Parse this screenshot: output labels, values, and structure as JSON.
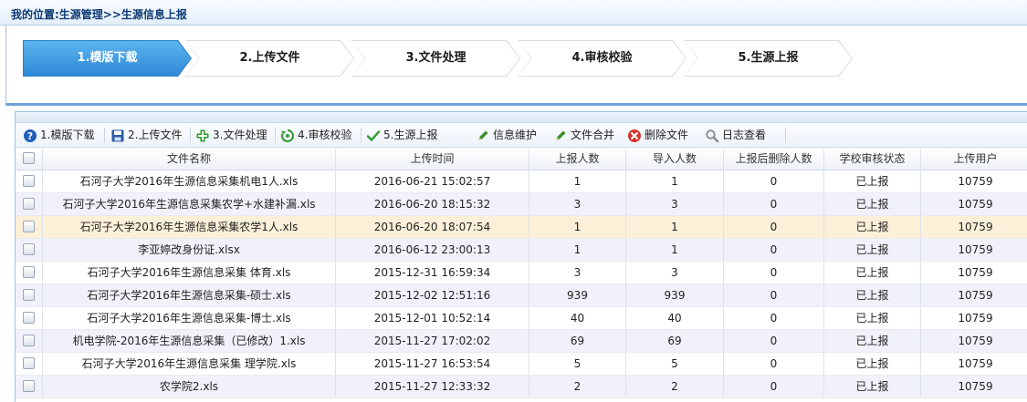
{
  "breadcrumb": "我的位置:生源管理>>生源信息上报",
  "steps": [
    {
      "label": "1.模版下载",
      "active": true
    },
    {
      "label": "2.上传文件",
      "active": false
    },
    {
      "label": "3.文件处理",
      "active": false
    },
    {
      "label": "4.审核校验",
      "active": false
    },
    {
      "label": "5.生源上报",
      "active": false
    }
  ],
  "toolbar": [
    {
      "label": "1.模版下载",
      "icon": "help-icon",
      "color": "#1f5fb8"
    },
    {
      "label": "2.上传文件",
      "icon": "save-icon",
      "color": "#2a5aa8"
    },
    {
      "label": "3.文件处理",
      "icon": "plus-icon",
      "color": "#2e9a2e"
    },
    {
      "label": "4.审核校验",
      "icon": "recycle-icon",
      "color": "#3a9a3a"
    },
    {
      "label": "5.生源上报",
      "icon": "check-icon",
      "color": "#2e9a2e"
    },
    {
      "label": "信息维护",
      "icon": "pencil-icon",
      "color": "#3f8f2f"
    },
    {
      "label": "文件合并",
      "icon": "pencil-icon",
      "color": "#3f8f2f"
    },
    {
      "label": "删除文件",
      "icon": "delete-icon",
      "color": "#d8322a"
    },
    {
      "label": "日志查看",
      "icon": "search-icon",
      "color": "#8a8a8a"
    }
  ],
  "table": {
    "columns": [
      "文件名称",
      "上传时间",
      "上报人数",
      "导入人数",
      "上报后删除人数",
      "学校审核状态",
      "上传用户"
    ],
    "rows": [
      [
        "石河子大学2016年生源信息采集机电1人.xls",
        "2016-06-21 15:02:57",
        "1",
        "1",
        "0",
        "已上报",
        "10759"
      ],
      [
        "石河子大学2016年生源信息采集农学+水建补漏.xls",
        "2016-06-20 18:15:32",
        "3",
        "3",
        "0",
        "已上报",
        "10759"
      ],
      [
        "石河子大学2016年生源信息采集农学1人.xls",
        "2016-06-20 18:07:54",
        "1",
        "1",
        "0",
        "已上报",
        "10759"
      ],
      [
        "李亚婷改身份证.xlsx",
        "2016-06-12 23:00:13",
        "1",
        "1",
        "0",
        "已上报",
        "10759"
      ],
      [
        "石河子大学2016年生源信息采集 体育.xls",
        "2015-12-31 16:59:34",
        "3",
        "3",
        "0",
        "已上报",
        "10759"
      ],
      [
        "石河子大学2016年生源信息采集-硕士.xls",
        "2015-12-02 12:51:16",
        "939",
        "939",
        "0",
        "已上报",
        "10759"
      ],
      [
        "石河子大学2016年生源信息采集-博士.xls",
        "2015-12-01 10:52:14",
        "40",
        "40",
        "0",
        "已上报",
        "10759"
      ],
      [
        "机电学院-2016年生源信息采集（已修改）1.xls",
        "2015-11-27 17:02:02",
        "69",
        "69",
        "0",
        "已上报",
        "10759"
      ],
      [
        "石河子大学2016年生源信息采集 理学院.xls",
        "2015-11-27 16:53:54",
        "5",
        "5",
        "0",
        "已上报",
        "10759"
      ],
      [
        "农学院2.xls",
        "2015-11-27 12:33:32",
        "2",
        "2",
        "0",
        "已上报",
        "10759"
      ]
    ],
    "selected_row": 2
  }
}
